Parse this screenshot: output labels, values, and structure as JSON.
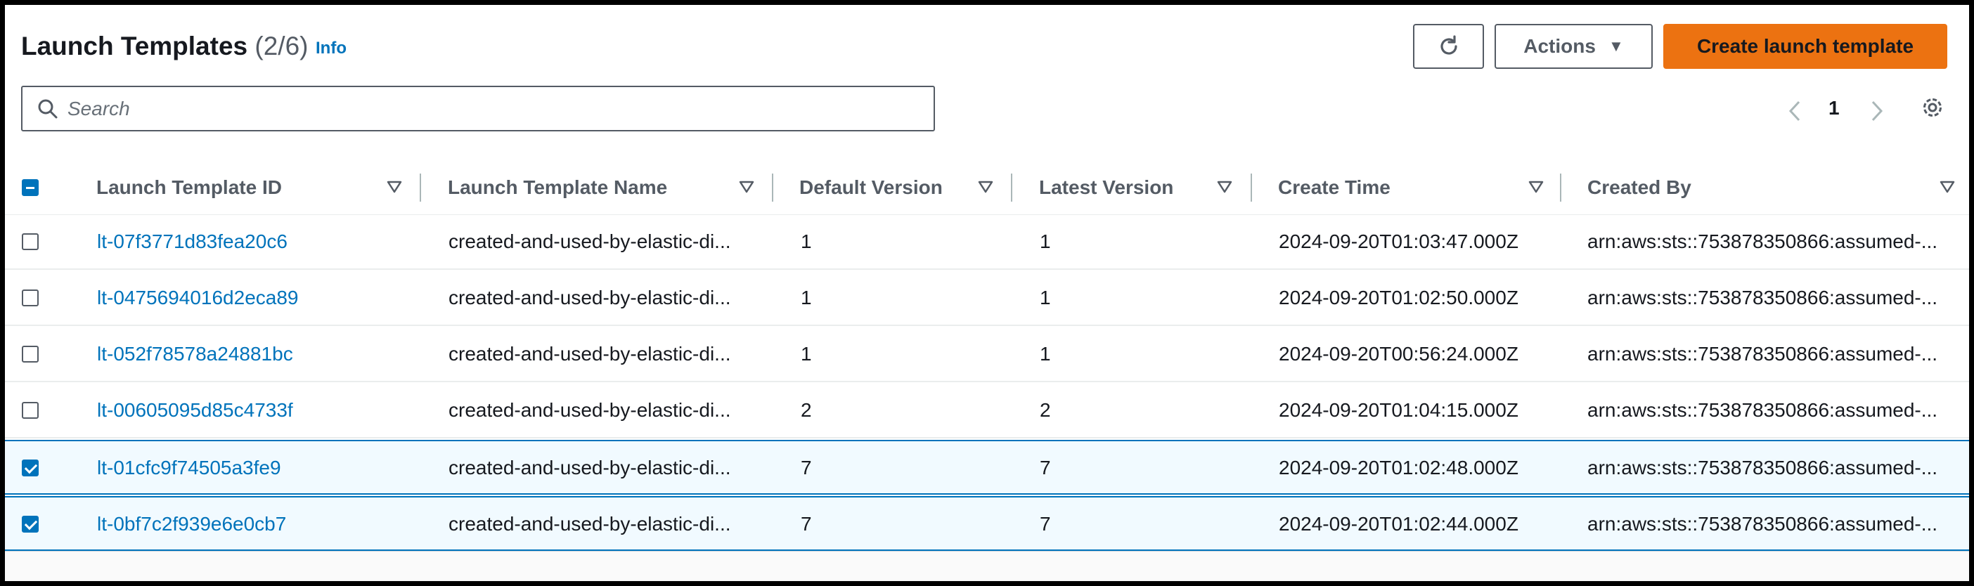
{
  "header": {
    "title": "Launch Templates",
    "count": "(2/6)",
    "info_label": "Info",
    "actions_label": "Actions",
    "create_label": "Create launch template"
  },
  "search": {
    "placeholder": "Search"
  },
  "pagination": {
    "current_page": "1"
  },
  "table": {
    "columns": [
      "Launch Template ID",
      "Launch Template Name",
      "Default Version",
      "Latest Version",
      "Create Time",
      "Created By"
    ],
    "rows": [
      {
        "selected": false,
        "id": "lt-07f3771d83fea20c6",
        "name": "created-and-used-by-elastic-di...",
        "default_version": "1",
        "latest_version": "1",
        "create_time": "2024-09-20T01:03:47.000Z",
        "created_by": "arn:aws:sts::753878350866:assumed-..."
      },
      {
        "selected": false,
        "id": "lt-0475694016d2eca89",
        "name": "created-and-used-by-elastic-di...",
        "default_version": "1",
        "latest_version": "1",
        "create_time": "2024-09-20T01:02:50.000Z",
        "created_by": "arn:aws:sts::753878350866:assumed-..."
      },
      {
        "selected": false,
        "id": "lt-052f78578a24881bc",
        "name": "created-and-used-by-elastic-di...",
        "default_version": "1",
        "latest_version": "1",
        "create_time": "2024-09-20T00:56:24.000Z",
        "created_by": "arn:aws:sts::753878350866:assumed-..."
      },
      {
        "selected": false,
        "id": "lt-00605095d85c4733f",
        "name": "created-and-used-by-elastic-di...",
        "default_version": "2",
        "latest_version": "2",
        "create_time": "2024-09-20T01:04:15.000Z",
        "created_by": "arn:aws:sts::753878350866:assumed-..."
      },
      {
        "selected": true,
        "id": "lt-01cfc9f74505a3fe9",
        "name": "created-and-used-by-elastic-di...",
        "default_version": "7",
        "latest_version": "7",
        "create_time": "2024-09-20T01:02:48.000Z",
        "created_by": "arn:aws:sts::753878350866:assumed-..."
      },
      {
        "selected": true,
        "id": "lt-0bf7c2f939e6e0cb7",
        "name": "created-and-used-by-elastic-di...",
        "default_version": "7",
        "latest_version": "7",
        "create_time": "2024-09-20T01:02:44.000Z",
        "created_by": "arn:aws:sts::753878350866:assumed-..."
      }
    ]
  },
  "icons": {
    "refresh": "refresh-icon",
    "search": "search-icon",
    "caret": "caret-down-icon",
    "prev": "chevron-left-icon",
    "next": "chevron-right-icon",
    "settings": "gear-icon"
  },
  "colors": {
    "accent": "#0073bb",
    "primary_button": "#ec7211",
    "selected_row": "#f1faff"
  }
}
